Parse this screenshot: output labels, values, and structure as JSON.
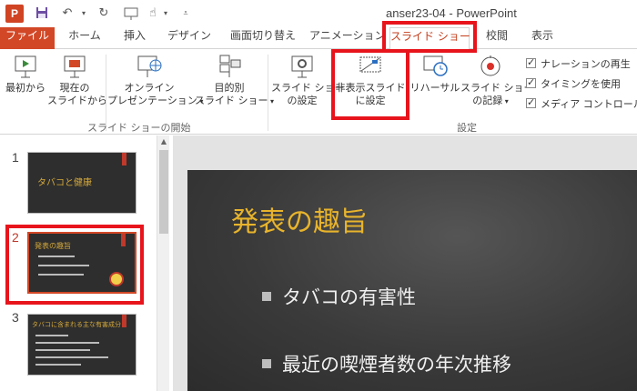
{
  "window": {
    "title": "anser23-04 - PowerPoint",
    "app_icon_letter": "P"
  },
  "tabs": [
    {
      "label": "ファイル"
    },
    {
      "label": "ホーム"
    },
    {
      "label": "挿入"
    },
    {
      "label": "デザイン"
    },
    {
      "label": "画面切り替え"
    },
    {
      "label": "アニメーション"
    },
    {
      "label": "スライド ショー"
    },
    {
      "label": "校閲"
    },
    {
      "label": "表示"
    }
  ],
  "active_tab": "スライド ショー",
  "ribbon": {
    "start": {
      "from_beginning": "最初から",
      "from_current_1": "現在の",
      "from_current_2": "スライドから",
      "online_1": "オンライン",
      "online_2": "プレゼンテーション",
      "custom_1": "目的別",
      "custom_2": "スライド ショー",
      "group_label": "スライド ショーの開始"
    },
    "setup": {
      "setup_1": "スライド ショー",
      "setup_2": "の設定",
      "hide_1": "非表示スライド",
      "hide_2": "に設定",
      "rehearse": "リハーサル",
      "record_1": "スライド ショー",
      "record_2": "の記録",
      "group_label": "設定"
    },
    "checkboxes": [
      {
        "label": "ナレーションの再生",
        "checked": true
      },
      {
        "label": "タイミングを使用",
        "checked": true
      },
      {
        "label": "メディア コントロールの表",
        "checked": true
      }
    ]
  },
  "thumbnails": [
    {
      "number": "1",
      "title": "タバコと健康"
    },
    {
      "number": "2",
      "title": "発表の趣旨",
      "selected": true
    },
    {
      "number": "3",
      "title": "タバコに含まれる主な有害成分"
    }
  ],
  "slide": {
    "title": "発表の趣旨",
    "bullets": [
      "タバコの有害性",
      "最近の喫煙者数の年次推移"
    ]
  },
  "colors": {
    "file_tab": "#d24726",
    "active_tab_text": "#c43e1c",
    "highlight": "#e8141c",
    "slide_title": "#e8b42c"
  }
}
